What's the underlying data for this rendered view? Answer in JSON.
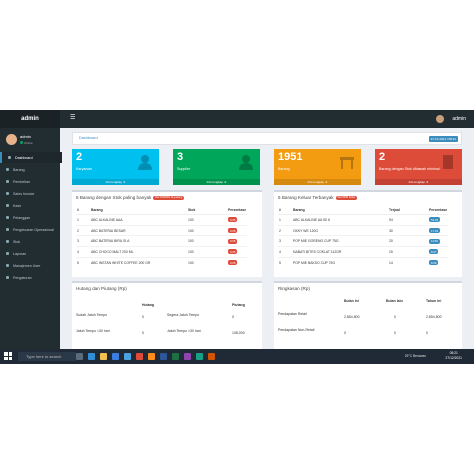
{
  "app": {
    "logo": "admin",
    "user": "admin"
  },
  "sidebar": {
    "user_name": "admin",
    "status": "Online",
    "items": [
      {
        "label": "Dashboard",
        "icon": "dashboard-icon"
      },
      {
        "label": "Barang",
        "icon": "box-icon"
      },
      {
        "label": "Pembelian",
        "icon": "cart-icon"
      },
      {
        "label": "Sales Invoice",
        "icon": "invoice-icon"
      },
      {
        "label": "Kasir",
        "icon": "cash-icon"
      },
      {
        "label": "Pelanggan",
        "icon": "users-icon"
      },
      {
        "label": "Pengeluaran Operasional",
        "icon": "wallet-icon"
      },
      {
        "label": "Stok",
        "icon": "stock-icon"
      },
      {
        "label": "Laporan",
        "icon": "report-icon"
      },
      {
        "label": "Manajemen User",
        "icon": "user-icon"
      },
      {
        "label": "Pengaturan",
        "icon": "gear-icon"
      }
    ]
  },
  "breadcrumb": {
    "label": "Dashboard",
    "date": "27-12-2021 / 08:21"
  },
  "tiles": [
    {
      "number": "2",
      "label": "Karyawan",
      "footer": "Info lengkap",
      "color": "#00c0ef",
      "icon": "user-icon"
    },
    {
      "number": "3",
      "label": "Supplier",
      "footer": "Info lengkap",
      "color": "#00a65a",
      "icon": "user-icon"
    },
    {
      "number": "1951",
      "label": "Barang",
      "footer": "Info lengkap",
      "color": "#f39c12",
      "icon": "table-icon"
    },
    {
      "number": "2",
      "label": "Barang dengan Stok dibawah minimal",
      "footer": "Info lengkap",
      "color": "#dd4b39",
      "icon": "document-icon"
    }
  ],
  "low_stock": {
    "title": "5 Barang dengan Stok paling banyak",
    "pill": "Ref #190001 di gudang",
    "columns": [
      "#",
      "Barang",
      "Stok",
      "Persentase"
    ],
    "rows": [
      {
        "no": "1",
        "name": "ABC ALKALINE AAA",
        "stock": "100",
        "pct": "0.05"
      },
      {
        "no": "2",
        "name": "ABC BATERAI BESAR",
        "stock": "100",
        "pct": "0.05"
      },
      {
        "no": "3",
        "name": "ABC BATERAI BIRU SI A",
        "stock": "100",
        "pct": "0.05"
      },
      {
        "no": "4",
        "name": "ABC CHOCO MALT 200 ML",
        "stock": "100",
        "pct": "0.05"
      },
      {
        "no": "5",
        "name": "ABC INSTAN WHITE COFFEE 200 GR",
        "stock": "100",
        "pct": "0.05"
      }
    ]
  },
  "top_out": {
    "title": "5 Barang Keluar Terbanyak",
    "pill": "Ref #150 bulan",
    "columns": [
      "#",
      "Barang",
      "Terjual",
      "Persentase"
    ],
    "rows": [
      {
        "no": "1",
        "name": "ABC ALKALINE AA ISI 6",
        "sold": "94",
        "pct": "54.33"
      },
      {
        "no": "2",
        "name": "OKKY WE 120G",
        "sold": "30",
        "pct": "17.34"
      },
      {
        "no": "3",
        "name": "POP MIE GORENG CUP 75G",
        "sold": "20",
        "pct": "11.56"
      },
      {
        "no": "4",
        "name": "NABATI BITES COKLAT 112GR",
        "sold": "15",
        "pct": "8.67"
      },
      {
        "no": "5",
        "name": "POP MIE BAKSO CUP 75G",
        "sold": "14",
        "pct": "8.09"
      }
    ]
  },
  "debts": {
    "title": "Hutang dan Piutang (Rp)",
    "col_hutang": "Hutang",
    "col_piutang": "Piutang",
    "rows": [
      {
        "l1": "Sudah Jatuh Tempo",
        "v1": "0",
        "l2": "Segera Jatuh Tempo",
        "v2": "0"
      },
      {
        "l1": "Jatuh Tempo <30 hari",
        "v1": "0",
        "l2": "Jatuh Tempo >30 hari",
        "v2": "108,000"
      }
    ]
  },
  "summary": {
    "title": "Ringkasan (Rp)",
    "columns": [
      "Bulan ini",
      "Bulan lalu",
      "Tahun ini"
    ],
    "rows": [
      {
        "label": "Pendapatan Retail",
        "a": "2,854,800",
        "b": "0",
        "c": "2,854,800"
      },
      {
        "label": "Pendapatan Non-Retail",
        "a": "0",
        "b": "0",
        "c": "0"
      }
    ]
  },
  "taskbar": {
    "search": "Type here to search",
    "weather": "29°C  Berawan",
    "time": "08:21",
    "date": "27/12/2021"
  }
}
